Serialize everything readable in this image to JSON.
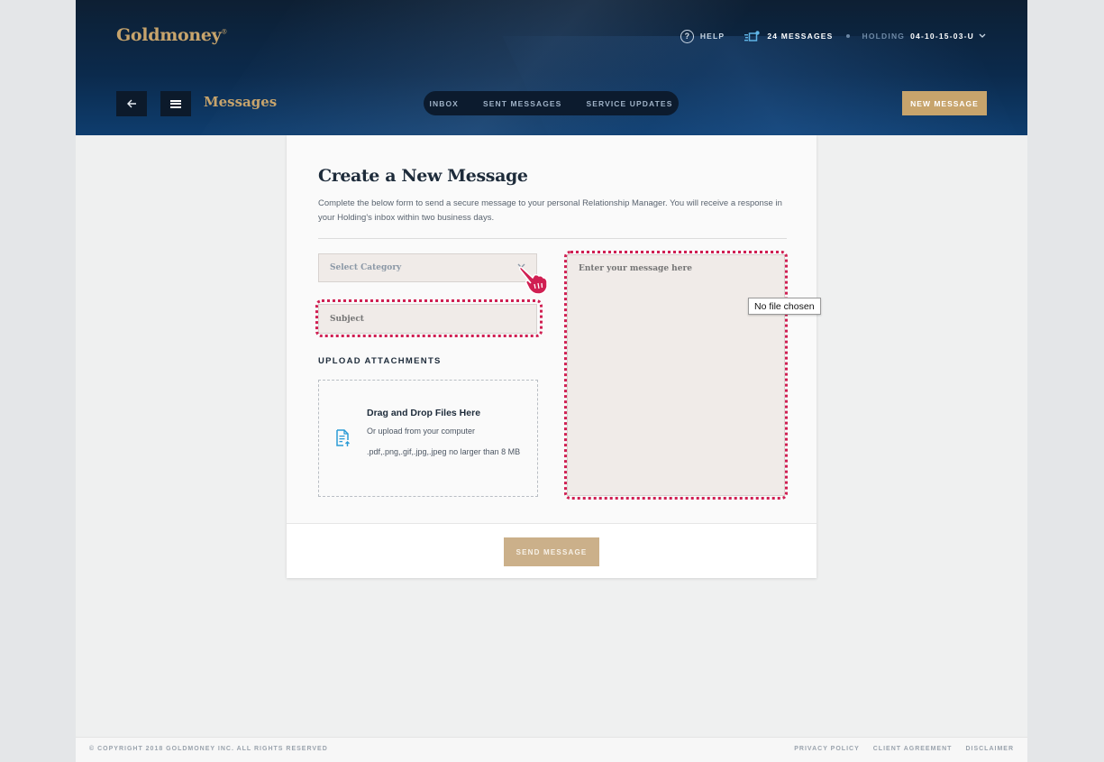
{
  "brand": {
    "name": "Goldmoney",
    "reg": "®"
  },
  "topnav": {
    "help_label": "HELP",
    "help_icon": "question-circle-icon",
    "messages_label": "24 MESSAGES",
    "messages_icon": "messages-icon",
    "holding_label": "HOLDING",
    "holding_value": "04-10-15-03-U"
  },
  "subheader": {
    "title": "Messages",
    "tabs": [
      {
        "label": "INBOX"
      },
      {
        "label": "SENT MESSAGES"
      },
      {
        "label": "SERVICE UPDATES"
      }
    ],
    "new_message_label": "NEW MESSAGE"
  },
  "form": {
    "title": "Create a New Message",
    "description": "Complete the below form to send a secure message to your personal Relationship Manager. You will receive a response in your Holding's inbox within two business days.",
    "category_placeholder": "Select Category",
    "subject_placeholder": "Subject",
    "upload_heading": "UPLOAD ATTACHMENTS",
    "dropzone": {
      "title": "Drag and Drop Files Here",
      "line1": "Or upload from your computer",
      "line2": ".pdf,.png,.gif,.jpg,.jpeg no larger than 8 MB"
    },
    "message_placeholder": "Enter your message here",
    "tooltip": "No file chosen",
    "send_label": "SEND MESSAGE"
  },
  "footer": {
    "copyright": "© COPYRIGHT 2018 GOLDMONEY INC. ALL RIGHTS RESERVED",
    "links": [
      {
        "label": "PRIVACY POLICY"
      },
      {
        "label": "CLIENT AGREEMENT"
      },
      {
        "label": "DISCLAIMER"
      }
    ]
  },
  "colors": {
    "gold": "#c7a46c",
    "navy": "#0b2a4c",
    "highlight": "#d01f52"
  }
}
